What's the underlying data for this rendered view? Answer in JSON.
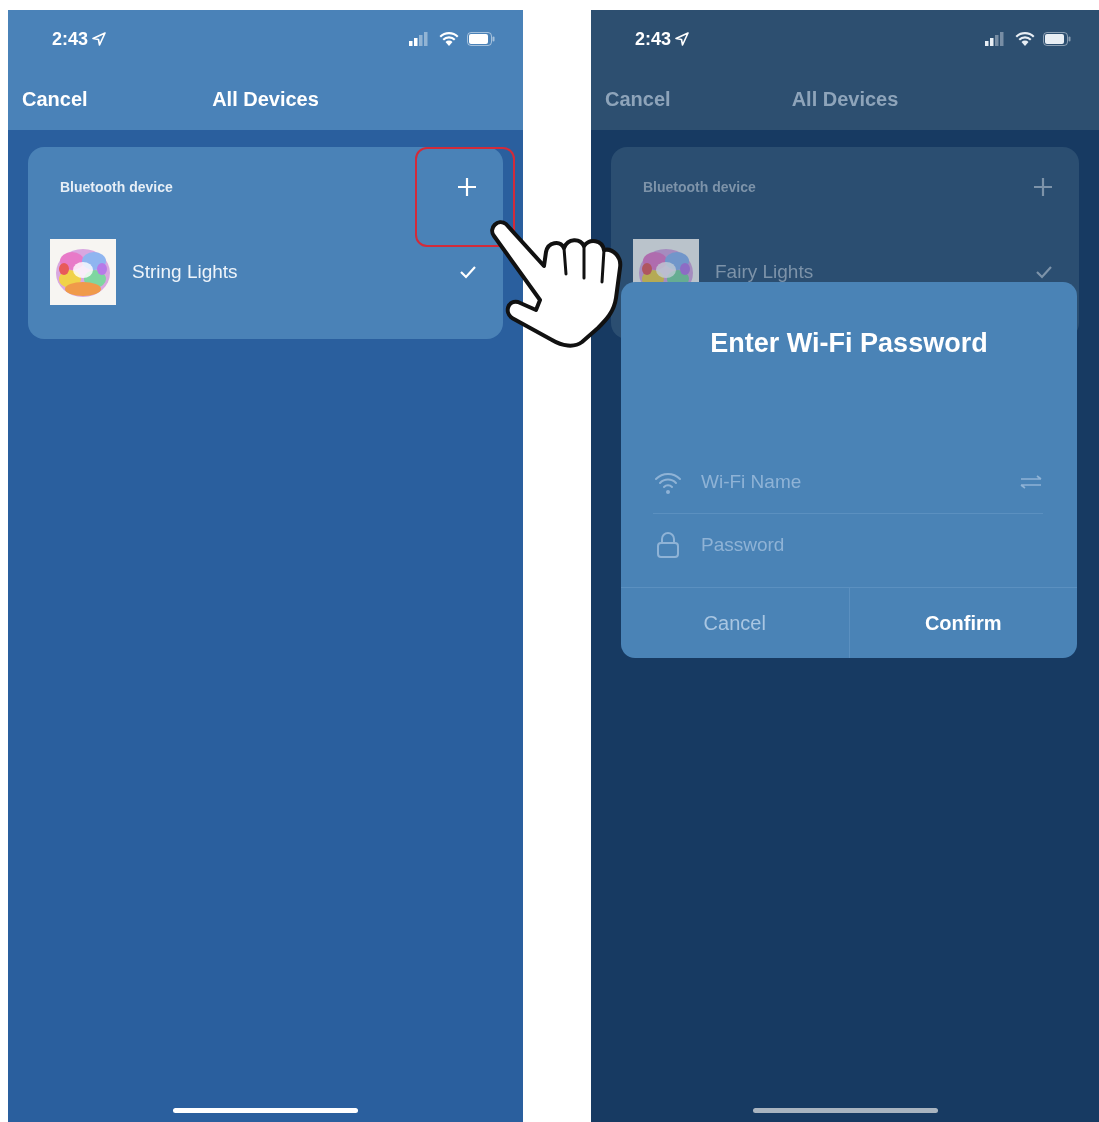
{
  "screens": [
    {
      "dimmed": false,
      "status_bar": {
        "time": "2:43"
      },
      "nav": {
        "cancel": "Cancel",
        "title": "All Devices"
      },
      "section": {
        "title": "Bluetooth device",
        "highlighted": true
      },
      "devices": [
        {
          "name": "String Lights",
          "checked": true
        }
      ]
    },
    {
      "dimmed": true,
      "status_bar": {
        "time": "2:43"
      },
      "nav": {
        "cancel": "Cancel",
        "title": "All Devices"
      },
      "section": {
        "title": "Bluetooth device",
        "highlighted": false
      },
      "devices": [
        {
          "name": "Fairy Lights",
          "checked": true
        }
      ],
      "dialog": {
        "title": "Enter Wi-Fi Password",
        "fields": [
          {
            "kind": "wifi",
            "placeholder": "Wi-Fi Name"
          },
          {
            "kind": "lock",
            "placeholder": "Password"
          }
        ],
        "buttons": [
          {
            "label": "Cancel",
            "primary": false
          },
          {
            "label": "Confirm",
            "primary": true
          }
        ]
      }
    }
  ]
}
